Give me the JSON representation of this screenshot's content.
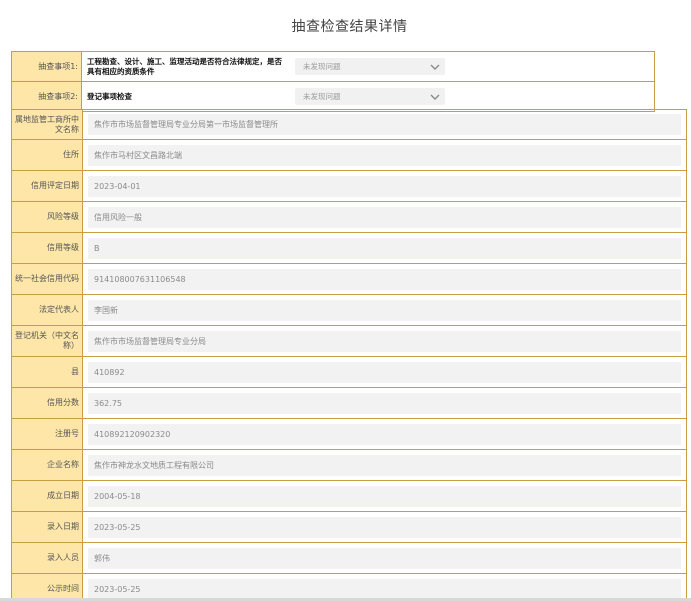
{
  "page": {
    "title": "抽查检查结果详情"
  },
  "inspection_items": [
    {
      "label": "抽查事项1:",
      "content": "工程勘查、设计、施工、监理活动是否符合法律规定，是否具有相应的资质条件",
      "result": "未发现问题"
    },
    {
      "label": "抽查事项2:",
      "content": "登记事项检查",
      "result": "未发现问题"
    }
  ],
  "details": [
    {
      "label": "属地监管工商所中文名称",
      "value": "焦作市市场监督管理局专业分局第一市场监督管理所"
    },
    {
      "label": "住所",
      "value": "焦作市马村区文昌路北端"
    },
    {
      "label": "信用评定日期",
      "value": "2023-04-01"
    },
    {
      "label": "风险等级",
      "value": "信用风险一般"
    },
    {
      "label": "信用等级",
      "value": "B"
    },
    {
      "label": "统一社会信用代码",
      "value": "914108007631106548"
    },
    {
      "label": "法定代表人",
      "value": "李国新"
    },
    {
      "label": "登记机关（中文名称）",
      "value": "焦作市市场监督管理局专业分局"
    },
    {
      "label": "县",
      "value": "410892"
    },
    {
      "label": "信用分数",
      "value": "362.75"
    },
    {
      "label": "注册号",
      "value": "410892120902320"
    },
    {
      "label": "企业名称",
      "value": "焦作市神龙水文地质工程有限公司"
    },
    {
      "label": "成立日期",
      "value": "2004-05-18"
    },
    {
      "label": "录入日期",
      "value": "2023-05-25"
    },
    {
      "label": "录入人员",
      "value": "郭伟"
    },
    {
      "label": "公示时间",
      "value": "2023-05-25"
    }
  ]
}
